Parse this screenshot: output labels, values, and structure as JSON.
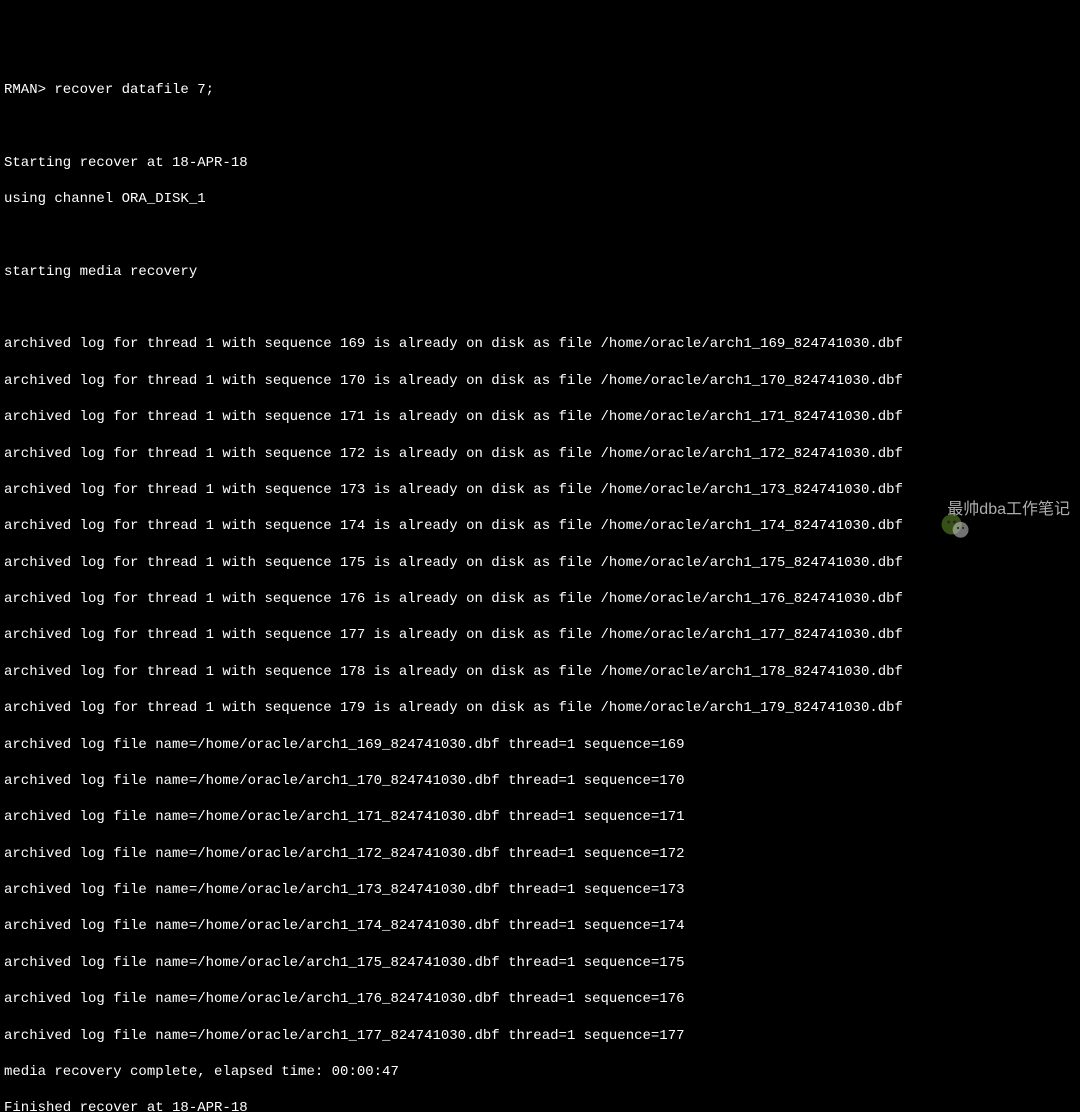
{
  "prompt_line": "RMAN> recover datafile 7;",
  "header": {
    "line1": "Starting recover at 18-APR-18",
    "line2": "using channel ORA_DISK_1",
    "line3": "starting media recovery"
  },
  "archived_on_disk": [
    "archived log for thread 1 with sequence 169 is already on disk as file /home/oracle/arch1_169_824741030.dbf",
    "archived log for thread 1 with sequence 170 is already on disk as file /home/oracle/arch1_170_824741030.dbf",
    "archived log for thread 1 with sequence 171 is already on disk as file /home/oracle/arch1_171_824741030.dbf",
    "archived log for thread 1 with sequence 172 is already on disk as file /home/oracle/arch1_172_824741030.dbf",
    "archived log for thread 1 with sequence 173 is already on disk as file /home/oracle/arch1_173_824741030.dbf",
    "archived log for thread 1 with sequence 174 is already on disk as file /home/oracle/arch1_174_824741030.dbf",
    "archived log for thread 1 with sequence 175 is already on disk as file /home/oracle/arch1_175_824741030.dbf",
    "archived log for thread 1 with sequence 176 is already on disk as file /home/oracle/arch1_176_824741030.dbf",
    "archived log for thread 1 with sequence 177 is already on disk as file /home/oracle/arch1_177_824741030.dbf",
    "archived log for thread 1 with sequence 178 is already on disk as file /home/oracle/arch1_178_824741030.dbf",
    "archived log for thread 1 with sequence 179 is already on disk as file /home/oracle/arch1_179_824741030.dbf"
  ],
  "archived_file_names": [
    "archived log file name=/home/oracle/arch1_169_824741030.dbf thread=1 sequence=169",
    "archived log file name=/home/oracle/arch1_170_824741030.dbf thread=1 sequence=170",
    "archived log file name=/home/oracle/arch1_171_824741030.dbf thread=1 sequence=171",
    "archived log file name=/home/oracle/arch1_172_824741030.dbf thread=1 sequence=172",
    "archived log file name=/home/oracle/arch1_173_824741030.dbf thread=1 sequence=173",
    "archived log file name=/home/oracle/arch1_174_824741030.dbf thread=1 sequence=174",
    "archived log file name=/home/oracle/arch1_175_824741030.dbf thread=1 sequence=175",
    "archived log file name=/home/oracle/arch1_176_824741030.dbf thread=1 sequence=176",
    "archived log file name=/home/oracle/arch1_177_824741030.dbf thread=1 sequence=177"
  ],
  "footer": {
    "line1": "media recovery complete, elapsed time: 00:00:47",
    "line2": "Finished recover at 18-APR-18"
  },
  "watermark": {
    "text": "最帅dba工作笔记"
  }
}
